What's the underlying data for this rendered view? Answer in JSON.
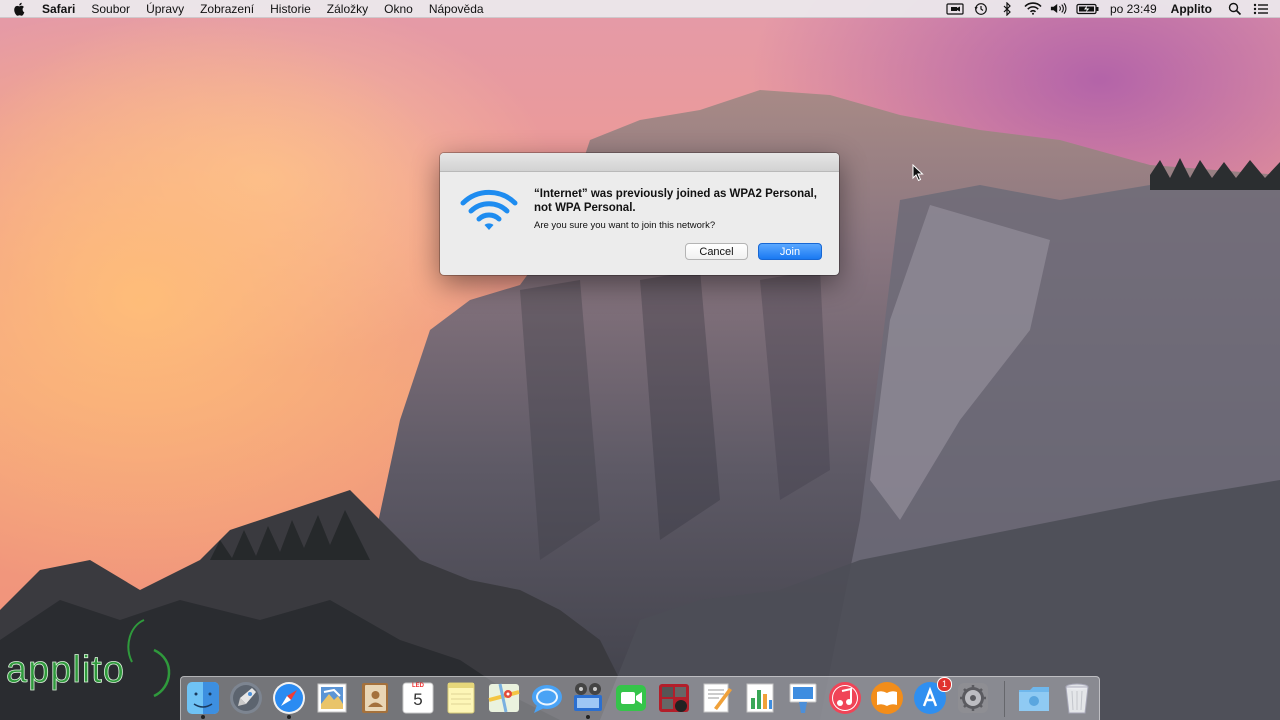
{
  "menubar": {
    "app_name": "Safari",
    "menus": [
      "Soubor",
      "Úpravy",
      "Zobrazení",
      "Historie",
      "Záložky",
      "Okno",
      "Nápověda"
    ],
    "status_icons": [
      "airplay-icon",
      "time-machine-icon",
      "bluetooth-icon",
      "wifi-icon",
      "volume-icon",
      "battery-icon"
    ],
    "clock": "po 23:49",
    "user": "Applito"
  },
  "dialog": {
    "message": "“Internet” was previously joined as WPA2 Personal, not WPA Personal.",
    "informative": "Are you sure you want to join this network?",
    "cancel_label": "Cancel",
    "join_label": "Join"
  },
  "watermark": {
    "text": "applito"
  },
  "dock": {
    "calendar_month": "LED",
    "calendar_day": "5",
    "app_store_badge": "1",
    "items": [
      {
        "name": "finder",
        "running": true
      },
      {
        "name": "launchpad",
        "running": false
      },
      {
        "name": "safari",
        "running": true
      },
      {
        "name": "mail",
        "running": false
      },
      {
        "name": "contacts",
        "running": false
      },
      {
        "name": "calendar",
        "running": false
      },
      {
        "name": "notes",
        "running": false
      },
      {
        "name": "maps",
        "running": false
      },
      {
        "name": "messages",
        "running": false
      },
      {
        "name": "keynote-projector",
        "running": true
      },
      {
        "name": "facetime",
        "running": false
      },
      {
        "name": "photo-booth",
        "running": false
      },
      {
        "name": "pages",
        "running": false
      },
      {
        "name": "numbers",
        "running": false
      },
      {
        "name": "keynote",
        "running": false
      },
      {
        "name": "itunes",
        "running": false
      },
      {
        "name": "ibooks",
        "running": false
      },
      {
        "name": "app-store",
        "running": false
      },
      {
        "name": "system-preferences",
        "running": false
      },
      {
        "name": "downloads-folder",
        "running": false
      },
      {
        "name": "trash",
        "running": false
      }
    ]
  },
  "colors": {
    "accent_blue": "#1a79f2",
    "wifi_blue": "#1e8cf0",
    "watermark_green": "#2f9a3c"
  }
}
